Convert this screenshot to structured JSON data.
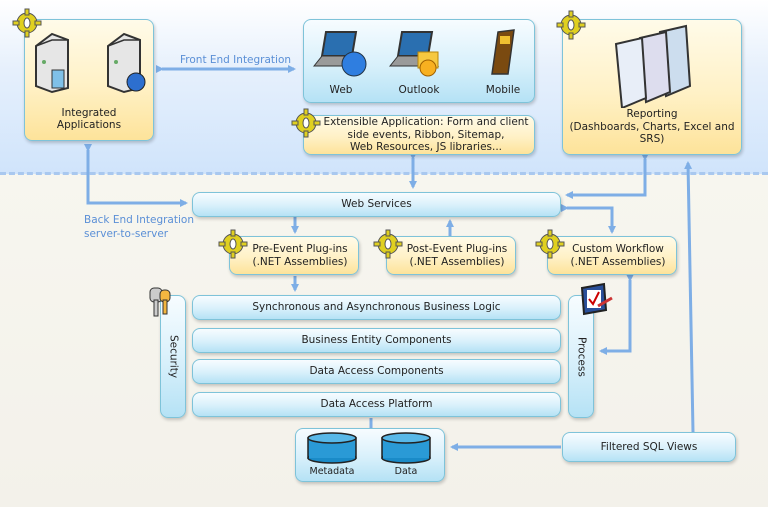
{
  "diagram": {
    "integrated_apps": {
      "label_line1": "Integrated",
      "label_line2": "Applications",
      "icons": [
        "server-icon",
        "server-globe-icon"
      ]
    },
    "front_end_label": "Front End Integration",
    "clients": [
      {
        "label": "Web",
        "icon": "laptop-globe-icon"
      },
      {
        "label": "Outlook",
        "icon": "laptop-mail-icon"
      },
      {
        "label": "Mobile",
        "icon": "mobile-phone-icon"
      }
    ],
    "extensible": {
      "line1": "Extensible Application:  Form and client",
      "line2": "side events, Ribbon,  Sitemap,",
      "line3": "Web Resources, JS libraries..."
    },
    "reporting": {
      "line1": "Reporting",
      "line2": "(Dashboards, Charts, Excel and",
      "line3": "SRS)"
    },
    "back_end_label": {
      "line1": "Back End Integration",
      "line2": "server-to-server"
    },
    "web_services": "Web Services",
    "pre_event": {
      "line1": "Pre-Event Plug-ins",
      "line2": "(.NET Assemblies)"
    },
    "post_event": {
      "line1": "Post-Event Plug-ins",
      "line2": "(.NET Assemblies)"
    },
    "custom_workflow": {
      "line1": "Custom Workflow",
      "line2": "(.NET Assemblies)"
    },
    "security": "Security",
    "process": "Process",
    "layers": [
      "Synchronous and Asynchronous Business Logic",
      "Business Entity  Components",
      "Data Access  Components",
      "Data Access Platform"
    ],
    "databases": [
      {
        "label": "Metadata"
      },
      {
        "label": "Data"
      }
    ],
    "filtered_sql": "Filtered SQL Views"
  },
  "colors": {
    "arrow": "#7eaee6",
    "box_border": "#7ec3d9",
    "gear": "#e0d020",
    "label": "#5a8fd6"
  }
}
